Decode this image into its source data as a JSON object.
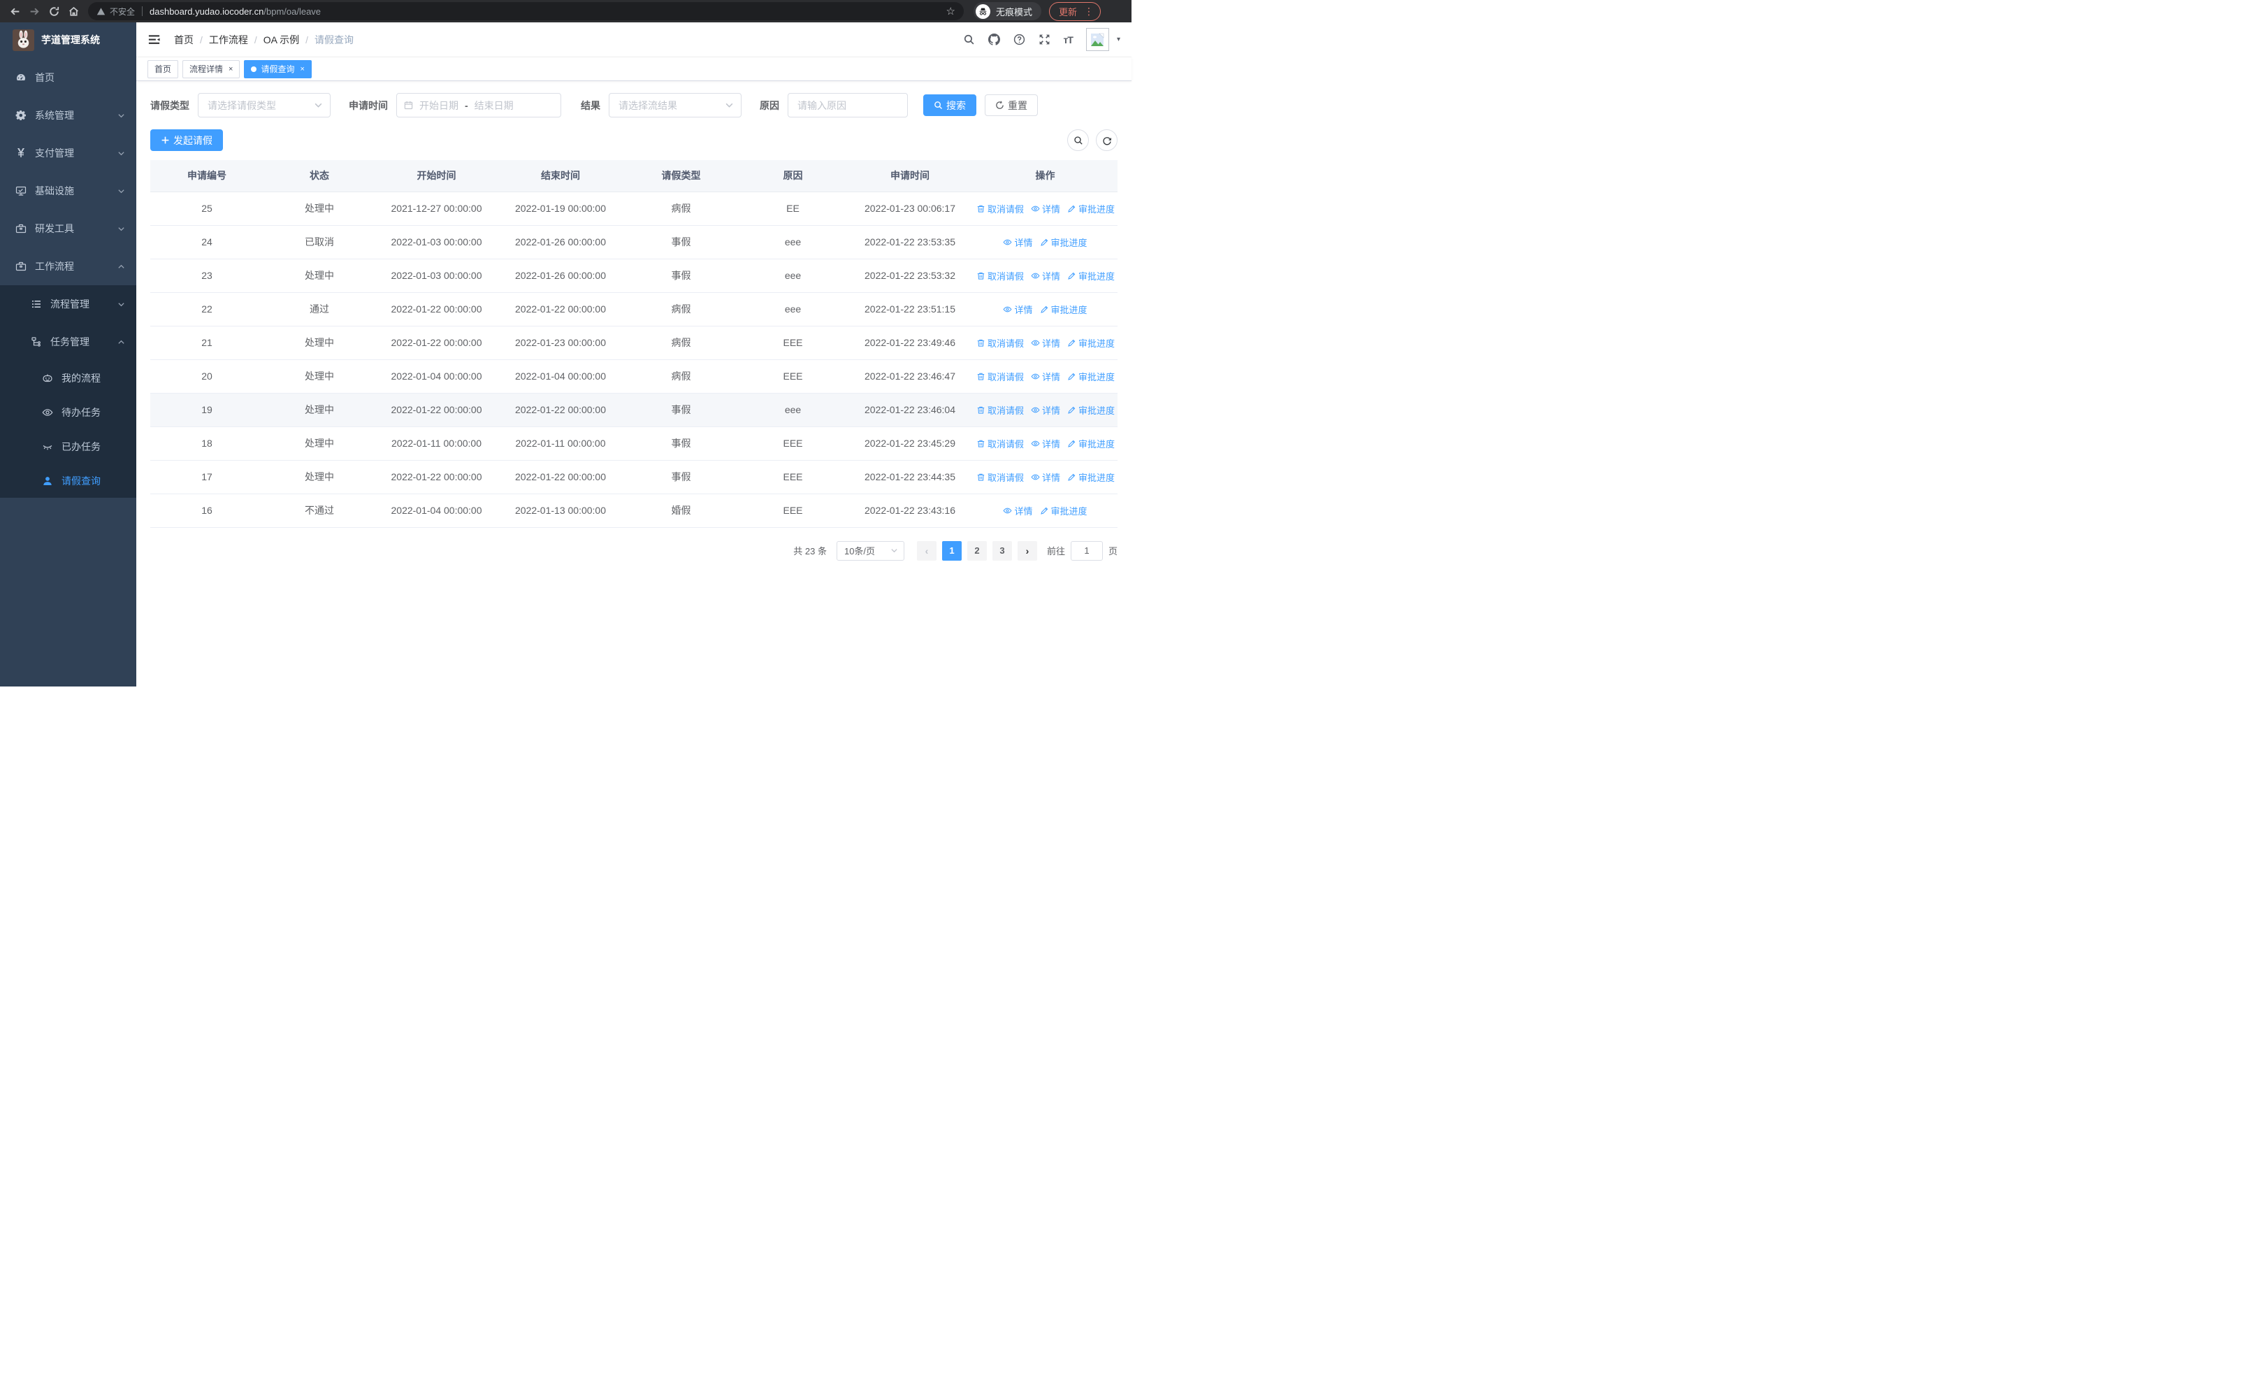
{
  "browser": {
    "security_label": "不安全",
    "url_host": "dashboard.yudao.iocoder.cn",
    "url_path": "/bpm/oa/leave",
    "incognito_label": "无痕模式",
    "update_label": "更新"
  },
  "sidebar": {
    "title": "芋道管理系统",
    "items": [
      {
        "label": "首页",
        "icon": "dashboard-icon",
        "level": 1,
        "chevron": "",
        "in_submenu": false,
        "active": false
      },
      {
        "label": "系统管理",
        "icon": "gear-icon",
        "level": 1,
        "chevron": "down",
        "in_submenu": false,
        "active": false
      },
      {
        "label": "支付管理",
        "icon": "yen-icon",
        "level": 1,
        "chevron": "down",
        "in_submenu": false,
        "active": false
      },
      {
        "label": "基础设施",
        "icon": "monitor-icon",
        "level": 1,
        "chevron": "down",
        "in_submenu": false,
        "active": false
      },
      {
        "label": "研发工具",
        "icon": "toolbox-icon",
        "level": 1,
        "chevron": "down",
        "in_submenu": false,
        "active": false
      },
      {
        "label": "工作流程",
        "icon": "briefcase-icon",
        "level": 1,
        "chevron": "up",
        "in_submenu": false,
        "active": false
      },
      {
        "label": "流程管理",
        "icon": "list-icon",
        "level": 2,
        "chevron": "down",
        "in_submenu": true,
        "active": false
      },
      {
        "label": "任务管理",
        "icon": "flow-icon",
        "level": 2,
        "chevron": "up",
        "in_submenu": true,
        "active": false
      },
      {
        "label": "我的流程",
        "icon": "robot-face-icon",
        "level": 3,
        "chevron": "",
        "in_submenu": true,
        "active": false
      },
      {
        "label": "待办任务",
        "icon": "eye-icon",
        "level": 3,
        "chevron": "",
        "in_submenu": true,
        "active": false
      },
      {
        "label": "已办任务",
        "icon": "eye-closed-icon",
        "level": 3,
        "chevron": "",
        "in_submenu": true,
        "active": false
      },
      {
        "label": "请假查询",
        "icon": "person-icon",
        "level": 3,
        "chevron": "",
        "in_submenu": true,
        "active": true
      }
    ]
  },
  "header": {
    "breadcrumb": [
      "首页",
      "工作流程",
      "OA 示例",
      "请假查询"
    ]
  },
  "tabs": [
    {
      "label": "首页",
      "active": false,
      "closable": false
    },
    {
      "label": "流程详情",
      "active": false,
      "closable": true
    },
    {
      "label": "请假查询",
      "active": true,
      "closable": true
    }
  ],
  "filters": {
    "leave_type_label": "请假类型",
    "leave_type_placeholder": "请选择请假类型",
    "apply_time_label": "申请时间",
    "start_date_placeholder": "开始日期",
    "range_separator": "-",
    "end_date_placeholder": "结束日期",
    "result_label": "结果",
    "result_placeholder": "请选择流结果",
    "reason_label": "原因",
    "reason_placeholder": "请输入原因",
    "search_label": "搜索",
    "reset_label": "重置"
  },
  "toolbar": {
    "create_label": "发起请假"
  },
  "table": {
    "columns": [
      "申请编号",
      "状态",
      "开始时间",
      "结束时间",
      "请假类型",
      "原因",
      "申请时间",
      "操作"
    ],
    "action_labels": {
      "cancel": "取消请假",
      "detail": "详情",
      "progress": "审批进度"
    },
    "rows": [
      {
        "id": "25",
        "status": "处理中",
        "start": "2021-12-27 00:00:00",
        "end": "2022-01-19 00:00:00",
        "type": "病假",
        "reason": "EE",
        "applied": "2022-01-23 00:06:17",
        "actions": [
          "cancel",
          "detail",
          "progress"
        ],
        "highlighted": false
      },
      {
        "id": "24",
        "status": "已取消",
        "start": "2022-01-03 00:00:00",
        "end": "2022-01-26 00:00:00",
        "type": "事假",
        "reason": "eee",
        "applied": "2022-01-22 23:53:35",
        "actions": [
          "detail",
          "progress"
        ],
        "highlighted": false
      },
      {
        "id": "23",
        "status": "处理中",
        "start": "2022-01-03 00:00:00",
        "end": "2022-01-26 00:00:00",
        "type": "事假",
        "reason": "eee",
        "applied": "2022-01-22 23:53:32",
        "actions": [
          "cancel",
          "detail",
          "progress"
        ],
        "highlighted": false
      },
      {
        "id": "22",
        "status": "通过",
        "start": "2022-01-22 00:00:00",
        "end": "2022-01-22 00:00:00",
        "type": "病假",
        "reason": "eee",
        "applied": "2022-01-22 23:51:15",
        "actions": [
          "detail",
          "progress"
        ],
        "highlighted": false
      },
      {
        "id": "21",
        "status": "处理中",
        "start": "2022-01-22 00:00:00",
        "end": "2022-01-23 00:00:00",
        "type": "病假",
        "reason": "EEE",
        "applied": "2022-01-22 23:49:46",
        "actions": [
          "cancel",
          "detail",
          "progress"
        ],
        "highlighted": false
      },
      {
        "id": "20",
        "status": "处理中",
        "start": "2022-01-04 00:00:00",
        "end": "2022-01-04 00:00:00",
        "type": "病假",
        "reason": "EEE",
        "applied": "2022-01-22 23:46:47",
        "actions": [
          "cancel",
          "detail",
          "progress"
        ],
        "highlighted": false
      },
      {
        "id": "19",
        "status": "处理中",
        "start": "2022-01-22 00:00:00",
        "end": "2022-01-22 00:00:00",
        "type": "事假",
        "reason": "eee",
        "applied": "2022-01-22 23:46:04",
        "actions": [
          "cancel",
          "detail",
          "progress"
        ],
        "highlighted": true
      },
      {
        "id": "18",
        "status": "处理中",
        "start": "2022-01-11 00:00:00",
        "end": "2022-01-11 00:00:00",
        "type": "事假",
        "reason": "EEE",
        "applied": "2022-01-22 23:45:29",
        "actions": [
          "cancel",
          "detail",
          "progress"
        ],
        "highlighted": false
      },
      {
        "id": "17",
        "status": "处理中",
        "start": "2022-01-22 00:00:00",
        "end": "2022-01-22 00:00:00",
        "type": "事假",
        "reason": "EEE",
        "applied": "2022-01-22 23:44:35",
        "actions": [
          "cancel",
          "detail",
          "progress"
        ],
        "highlighted": false
      },
      {
        "id": "16",
        "status": "不通过",
        "start": "2022-01-04 00:00:00",
        "end": "2022-01-13 00:00:00",
        "type": "婚假",
        "reason": "EEE",
        "applied": "2022-01-22 23:43:16",
        "actions": [
          "detail",
          "progress"
        ],
        "highlighted": false
      }
    ]
  },
  "pagination": {
    "total_label": "共 23 条",
    "page_size_label": "10条/页",
    "pages": [
      "1",
      "2",
      "3"
    ],
    "current_page": "1",
    "goto_label": "前往",
    "goto_value": "1",
    "page_unit_label": "页"
  },
  "colors": {
    "primary": "#409eff",
    "sidebar_bg": "#304156",
    "submenu_bg": "#1f2d3d"
  }
}
